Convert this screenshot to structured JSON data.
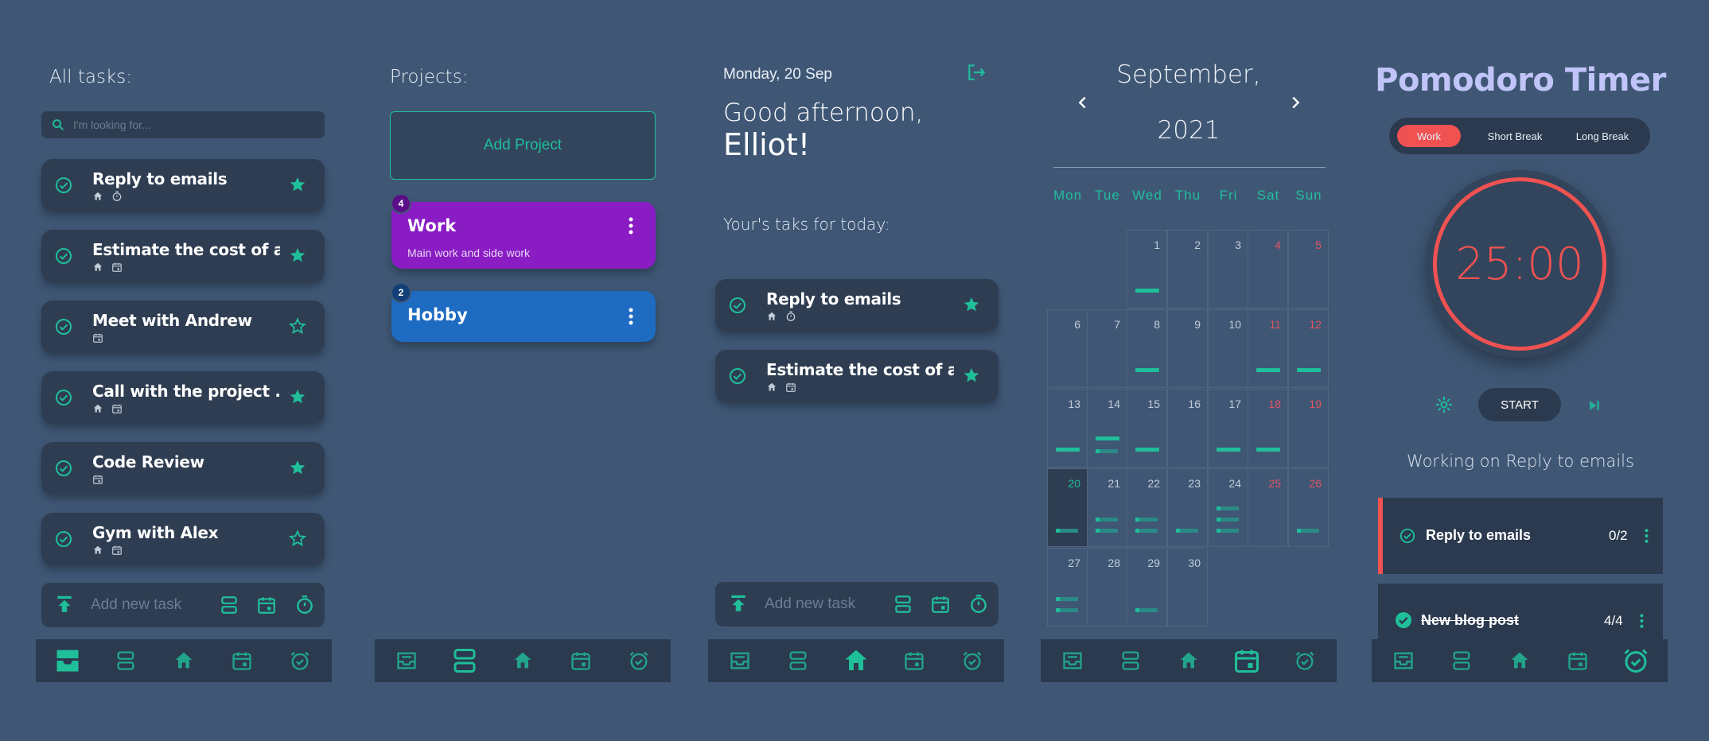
{
  "colors": {
    "background": "#3f5775",
    "card": "#2e3d51",
    "accent": "#1fbf9a",
    "danger": "#f05252",
    "purple": "#8a1cc4",
    "blue": "#1e6bc2",
    "pomodoro_title": "#c0c4f8"
  },
  "screens": {
    "all_tasks": {
      "title": "All tasks:",
      "search_placeholder": "I'm looking for...",
      "tasks": [
        {
          "title": "Reply to emails",
          "meta_icons": [
            "home-icon",
            "timer-icon"
          ],
          "starred": true
        },
        {
          "title": "Estimate the cost of a...",
          "meta_icons": [
            "home-icon",
            "calendar-icon"
          ],
          "starred": true
        },
        {
          "title": "Meet with Andrew",
          "meta_icons": [
            "calendar-icon"
          ],
          "starred": false
        },
        {
          "title": "Call with the project ...",
          "meta_icons": [
            "home-icon",
            "calendar-icon"
          ],
          "starred": true
        },
        {
          "title": "Code Review",
          "meta_icons": [
            "calendar-icon"
          ],
          "starred": true
        },
        {
          "title": "Gym with Alex",
          "meta_icons": [
            "home-icon",
            "calendar-icon"
          ],
          "starred": false
        }
      ],
      "add_task_label": "Add new task"
    },
    "projects": {
      "title": "Projects:",
      "add_project_label": "Add Project",
      "items": [
        {
          "name": "Work",
          "description": "Main work and side work",
          "count": "4",
          "color": "#8a1cc4"
        },
        {
          "name": "Hobby",
          "description": "",
          "count": "2",
          "color": "#1e6bc2"
        }
      ]
    },
    "home": {
      "date": "Monday, 20 Sep",
      "greeting": "Good afternoon,",
      "name": "Elliot!",
      "subtitle": "Your's taks for today:",
      "tasks": [
        {
          "title": "Reply to emails",
          "meta_icons": [
            "home-icon",
            "timer-icon"
          ],
          "starred": true
        },
        {
          "title": "Estimate the cost of a...",
          "meta_icons": [
            "home-icon",
            "calendar-icon"
          ],
          "starred": true
        }
      ],
      "add_task_label": "Add new task"
    },
    "calendar": {
      "month": "September,",
      "year": "2021",
      "weekdays": [
        "Mon",
        "Tue",
        "Wed",
        "Thu",
        "Fri",
        "Sat",
        "Sun"
      ],
      "weeks": [
        [
          "",
          "",
          "1",
          "2",
          "3",
          "4",
          "5"
        ],
        [
          "6",
          "7",
          "8",
          "9",
          "10",
          "11",
          "12"
        ],
        [
          "13",
          "14",
          "15",
          "16",
          "17",
          "18",
          "19"
        ],
        [
          "20",
          "21",
          "22",
          "23",
          "24",
          "25",
          "26"
        ],
        [
          "27",
          "28",
          "29",
          "30",
          "",
          "",
          ""
        ]
      ],
      "today": "20"
    },
    "pomodoro": {
      "title": "Pomodoro Timer",
      "tabs": [
        "Work",
        "Short Break",
        "Long Break"
      ],
      "active_tab": "Work",
      "time": "25:00",
      "start_label": "START",
      "working_on": "Working on Reply to emails",
      "tasks": [
        {
          "title": "Reply to emails",
          "progress": "0/2",
          "done": false
        },
        {
          "title": "New blog post",
          "progress": "4/4",
          "done": true
        }
      ]
    }
  },
  "nav_items": [
    "inbox-icon",
    "projects-icon",
    "home-icon",
    "calendar-icon",
    "alarm-icon"
  ],
  "active_nav_per_screen": [
    "inbox-icon",
    "projects-icon",
    "home-icon",
    "calendar-icon",
    "alarm-icon"
  ]
}
